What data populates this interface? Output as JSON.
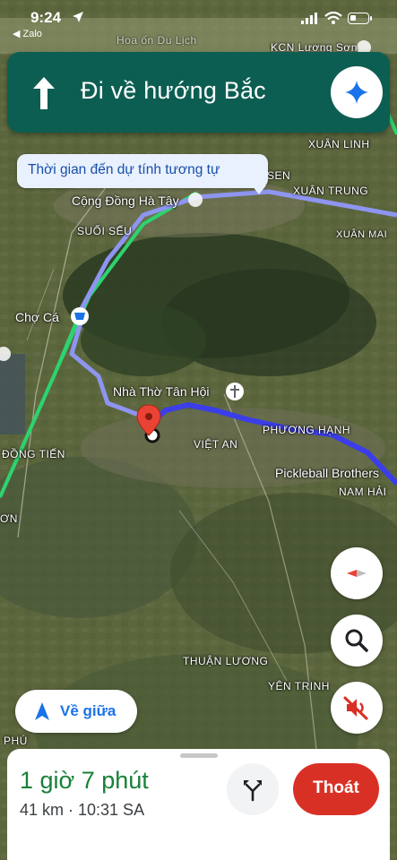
{
  "status_bar": {
    "time": "9:24",
    "back_app": "◀ Zalo"
  },
  "banner": {
    "direction_text": "Đi về hướng Bắc"
  },
  "tooltip": {
    "text": "Thời gian đến dự tính tương tự"
  },
  "map_labels": {
    "kcn": "KCN Lương Sơn",
    "xuan_linh": "XUÂN LINH",
    "sen": "SEN",
    "xuan_trung": "XUÂN TRUNG",
    "cong_dong": "Cộng Đồng Hà Tây",
    "suoi_seu": "SUỐI SẾU",
    "xuan_mai": "XUÂN MAI",
    "cho_ca": "Chợ Cá",
    "nha_tho": "Nhà Thờ Tân Hội",
    "phuong_hanh": "PHƯƠNG HẠNH",
    "viet_an": "VIỆT AN",
    "dong_tien": "ĐỒNG TIẾN",
    "pickleball": "Pickleball Brothers",
    "nam_hai": "NAM HẢI",
    "on": "ƠN",
    "thuan_luong": "THUẬN LƯƠNG",
    "yen_trinh": "YÊN TRINH",
    "phu": "PHÚ",
    "top_partial": "Hoa ốn Du Lịch"
  },
  "buttons": {
    "recenter_label": "Về giữa",
    "exit_label": "Thoát"
  },
  "trip": {
    "eta_duration": "1 giờ 7 phút",
    "distance_arrival": "41 km · 10:31 SA"
  },
  "colors": {
    "banner_bg": "#0d5e52",
    "route_main": "#3b3ee8",
    "route_alt": "#8e95f0",
    "exit_red": "#d93025",
    "eta_green": "#188038",
    "highway_green": "#2dd36f"
  }
}
